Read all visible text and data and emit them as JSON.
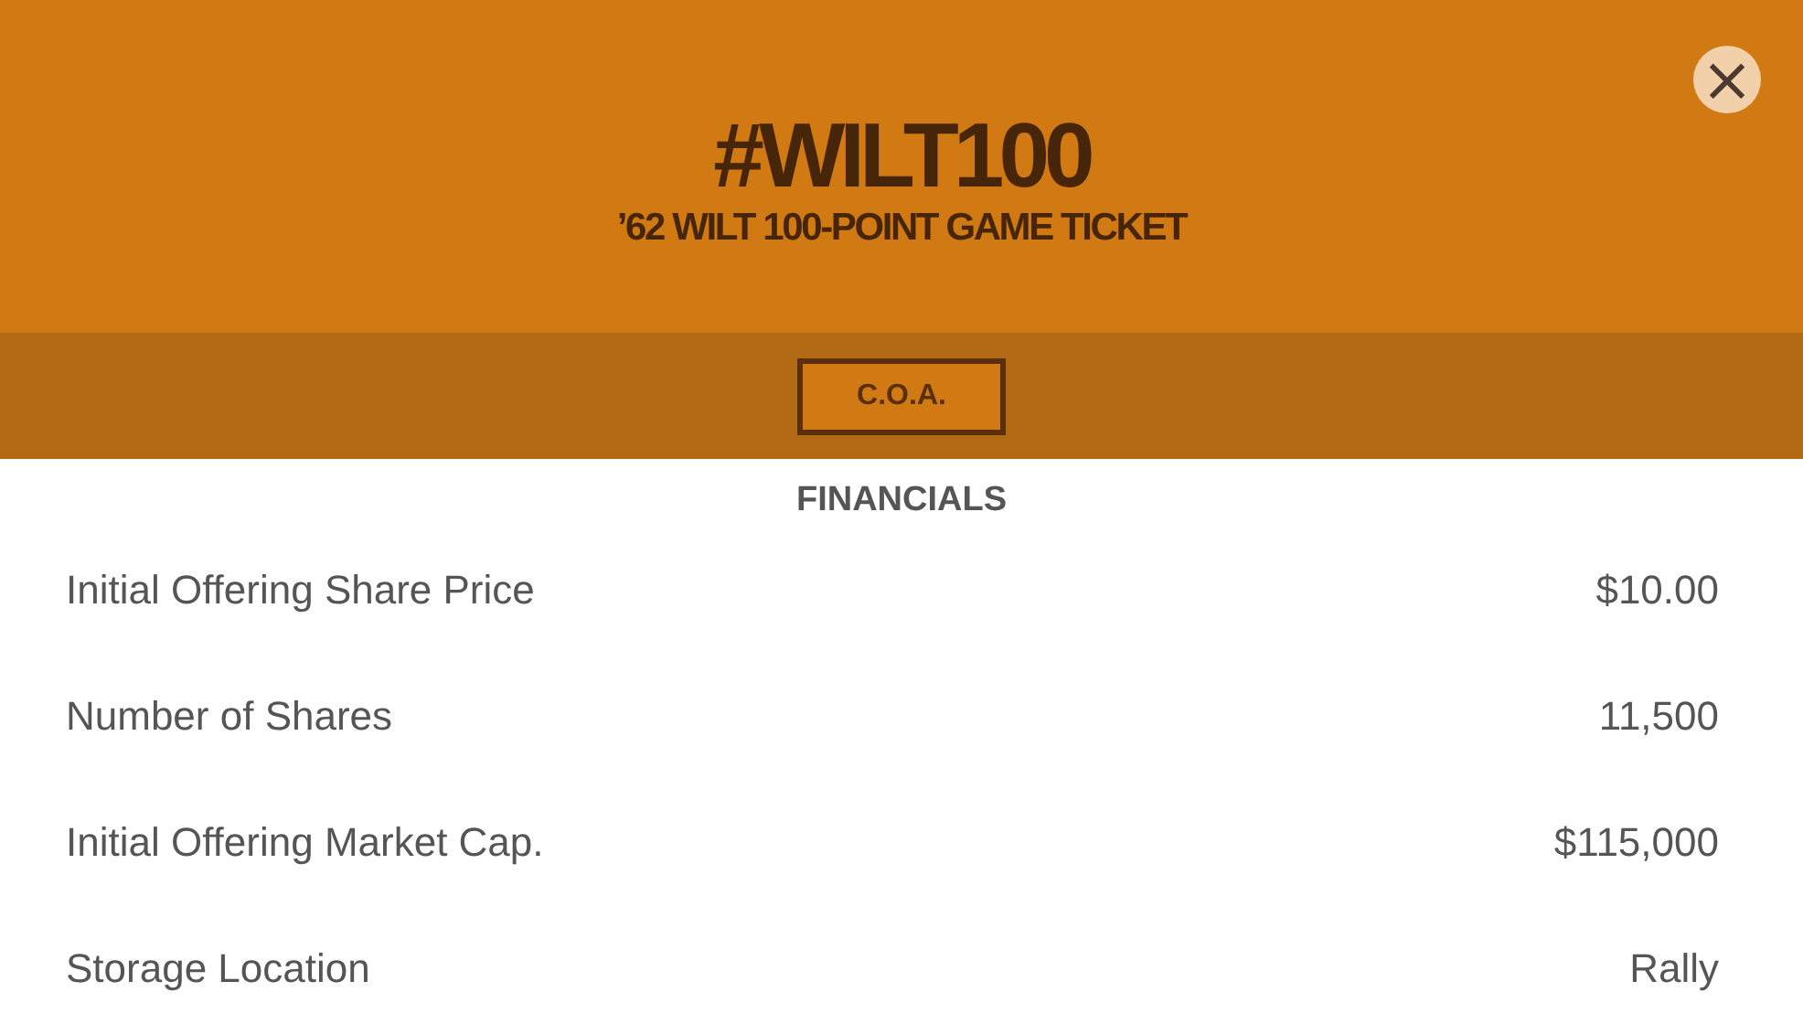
{
  "header": {
    "title": "#WILT100",
    "subtitle": "’62 WILT 100-POINT GAME TICKET",
    "close": "×"
  },
  "tabs": [
    {
      "label": "C.O.A.",
      "selected": true
    }
  ],
  "financials": {
    "heading": "FINANCIALS",
    "rows": [
      {
        "label": "Initial Offering Share Price",
        "value": "$10.00"
      },
      {
        "label": "Number of Shares",
        "value": "11,500"
      },
      {
        "label": "Initial Offering Market Cap.",
        "value": "$115,000"
      },
      {
        "label": "Storage Location",
        "value": "Rally"
      }
    ]
  }
}
